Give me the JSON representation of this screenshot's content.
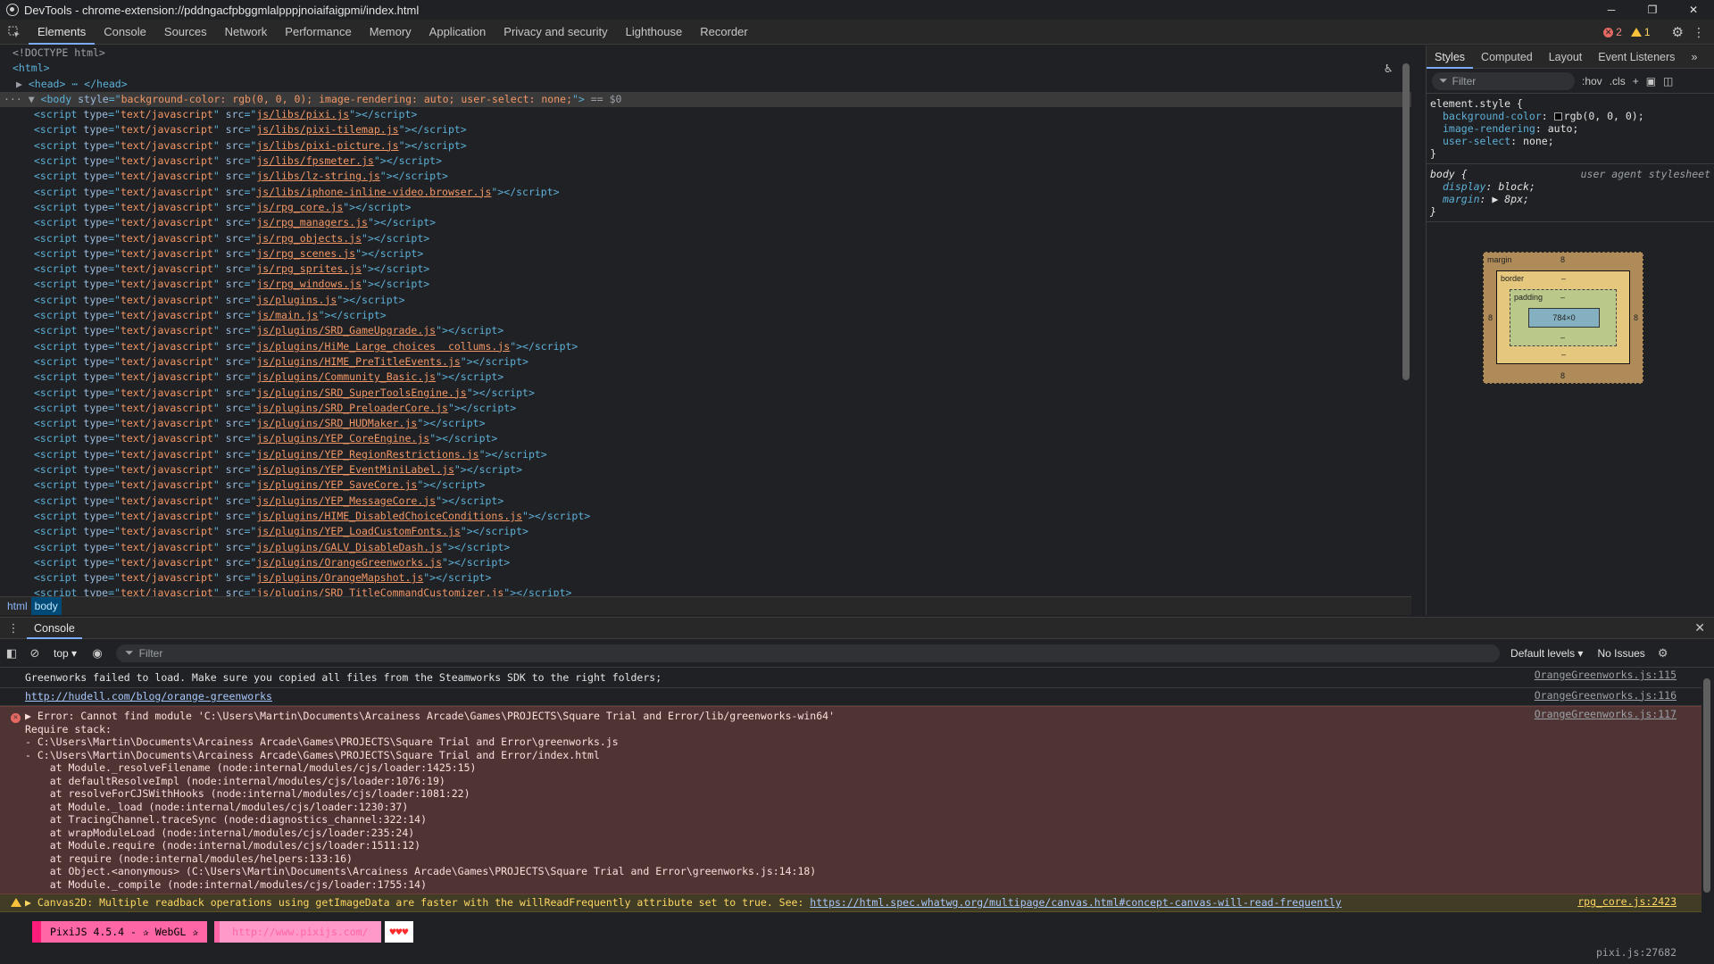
{
  "window": {
    "title": "DevTools - chrome-extension://pddngacfpbggmlalpppjnoiaifaigpmi/index.html",
    "controls": [
      "─",
      "❐",
      "✕"
    ]
  },
  "main_tabs": [
    "Elements",
    "Console",
    "Sources",
    "Network",
    "Performance",
    "Memory",
    "Application",
    "Privacy and security",
    "Lighthouse",
    "Recorder"
  ],
  "status": {
    "errors": "2",
    "warnings": "1"
  },
  "elements": {
    "doctype": "<!DOCTYPE html>",
    "html_open": "<html>",
    "head_collapsed": "<head> ⋯ </head>",
    "body_style": "background-color: rgb(0, 0, 0); image-rendering: auto; user-select: none;",
    "selected_marker": "== $0",
    "scripts": [
      "js/libs/pixi.js",
      "js/libs/pixi-tilemap.js",
      "js/libs/pixi-picture.js",
      "js/libs/fpsmeter.js",
      "js/libs/lz-string.js",
      "js/libs/iphone-inline-video.browser.js",
      "js/rpg_core.js",
      "js/rpg_managers.js",
      "js/rpg_objects.js",
      "js/rpg_scenes.js",
      "js/rpg_sprites.js",
      "js/rpg_windows.js",
      "js/plugins.js",
      "js/main.js",
      "js/plugins/SRD_GameUpgrade.js",
      "js/plugins/HiMe_Large_choices  collums.js",
      "js/plugins/HIME_PreTitleEvents.js",
      "js/plugins/Community_Basic.js",
      "js/plugins/SRD_SuperToolsEngine.js",
      "js/plugins/SRD_PreloaderCore.js",
      "js/plugins/SRD_HUDMaker.js",
      "js/plugins/YEP_CoreEngine.js",
      "js/plugins/YEP_RegionRestrictions.js",
      "js/plugins/YEP_EventMiniLabel.js",
      "js/plugins/YEP_SaveCore.js",
      "js/plugins/YEP_MessageCore.js",
      "js/plugins/HIME_DisabledChoiceConditions.js",
      "js/plugins/YEP_LoadCustomFonts.js",
      "js/plugins/GALV_DisableDash.js",
      "js/plugins/OrangeGreenworks.js",
      "js/plugins/OrangeMapshot.js",
      "js/plugins/SRD_TitleCommandCustomizer.js"
    ],
    "breadcrumbs": [
      "html",
      "body"
    ]
  },
  "styles": {
    "tabs": [
      "Styles",
      "Computed",
      "Layout",
      "Event Listeners",
      "»"
    ],
    "filter_placeholder": "Filter",
    "toolbar": [
      ":hov",
      ".cls",
      "+"
    ],
    "element_style": {
      "selector": "element.style {",
      "props": [
        {
          "name": "background-color",
          "value": "rgb(0, 0, 0);"
        },
        {
          "name": "image-rendering",
          "value": "auto;"
        },
        {
          "name": "user-select",
          "value": "none;"
        }
      ]
    },
    "body_rule": {
      "selector": "body {",
      "origin": "user agent stylesheet",
      "props": [
        {
          "name": "display",
          "value": "block;"
        },
        {
          "name": "margin",
          "value": "▶ 8px;"
        }
      ]
    },
    "box_model": {
      "margin_label": "margin",
      "border_label": "border",
      "padding_label": "padding",
      "margin_top": "8",
      "margin_bottom": "8",
      "margin_left": "8",
      "margin_right": "8",
      "border_value": "–",
      "padding_value": "–",
      "content": "784×0"
    }
  },
  "drawer": {
    "tab": "Console",
    "context": "top ▾",
    "filter_placeholder": "Filter",
    "levels": "Default levels ▾",
    "issues": "No Issues"
  },
  "console": {
    "messages": [
      {
        "text": "Greenworks failed to load. Make sure you copied all files from the Steamworks SDK to the right folders;",
        "source": "OrangeGreenworks.js:115"
      },
      {
        "text": "http://hudell.com/blog/orange-greenworks",
        "source": "OrangeGreenworks.js:116"
      }
    ],
    "error": {
      "source": "OrangeGreenworks.js:117",
      "lines": [
        "▶ Error: Cannot find module 'C:\\Users\\Martin\\Documents\\Arcainess Arcade\\Games\\PROJECTS\\Square Trial and Error/lib/greenworks-win64'",
        "Require stack:",
        "- C:\\Users\\Martin\\Documents\\Arcainess Arcade\\Games\\PROJECTS\\Square Trial and Error\\greenworks.js",
        "- C:\\Users\\Martin\\Documents\\Arcainess Arcade\\Games\\PROJECTS\\Square Trial and Error/index.html",
        "    at Module._resolveFilename (node:internal/modules/cjs/loader:1425:15)",
        "    at defaultResolveImpl (node:internal/modules/cjs/loader:1076:19)",
        "    at resolveForCJSWithHooks (node:internal/modules/cjs/loader:1081:22)",
        "    at Module._load (node:internal/modules/cjs/loader:1230:37)",
        "    at TracingChannel.traceSync (node:diagnostics_channel:322:14)",
        "    at wrapModuleLoad (node:internal/modules/cjs/loader:235:24)",
        "    at Module.require (node:internal/modules/cjs/loader:1511:12)",
        "    at require (node:internal/modules/helpers:133:16)",
        "    at Object.<anonymous> (C:\\Users\\Martin\\Documents\\Arcainess Arcade\\Games\\PROJECTS\\Square Trial and Error\\greenworks.js:14:18)",
        "    at Module._compile (node:internal/modules/cjs/loader:1755:14)"
      ]
    },
    "warning": {
      "text": "▶ Canvas2D: Multiple readback operations using getImageData are faster with the willReadFrequently attribute set to true. See: ",
      "link": "https://html.spec.whatwg.org/multipage/canvas.html#concept-canvas-will-read-frequently",
      "source": "rpg_core.js:2423"
    },
    "pixi": {
      "label": "PixiJS 4.5.4 - ✰ WebGL ✰",
      "link": "http://www.pixijs.com/",
      "hearts": "♥♥♥",
      "source": "pixi.js:27682"
    }
  },
  "colors": {
    "accent": "#7cacf8",
    "error_bg": "#4e3534",
    "warning_bg": "#413c26",
    "pixi_pink": "#ff66a5"
  }
}
